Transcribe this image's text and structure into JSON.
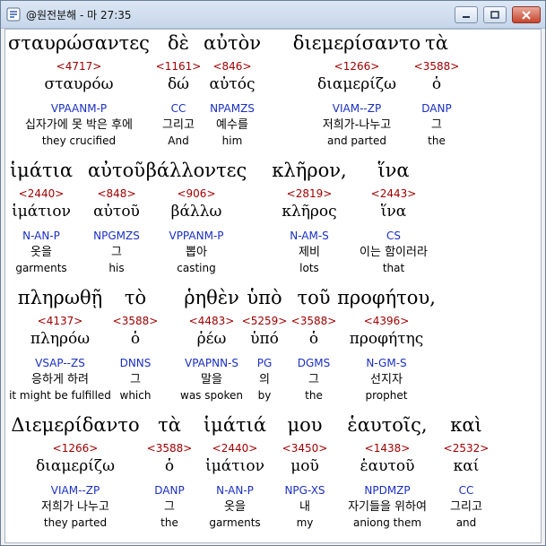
{
  "window": {
    "title": "@원전분해 - 마 27:35",
    "buttons": {
      "minimize": "minimize",
      "maximize": "maximize",
      "close": "close"
    }
  },
  "rows": [
    {
      "words": [
        {
          "greek": "σταυρώσαντες",
          "strong": "<4717>",
          "lexeme": "σταυρόω",
          "parse": "VPAANM-P",
          "korean": "십자가에 못 박은 후에",
          "english": "they crucified",
          "highlighted": true
        },
        {
          "greek": "δὲ",
          "strong": "<1161>",
          "lexeme": "δώ",
          "parse": "CC",
          "korean": "그리고",
          "english": "And"
        },
        {
          "greek": "αὐτὸν",
          "strong": "<846>",
          "lexeme": "αὐτός",
          "parse": "NPAMZS",
          "korean": "예수를",
          "english": "him"
        },
        {
          "greek": "διεμερίσαντο",
          "strong": "<1266>",
          "lexeme": "διαμερίζω",
          "parse": "VIAM--ZP",
          "korean": "저희가-나누고",
          "english": "and parted"
        },
        {
          "greek": "τὰ",
          "strong": "<3588>",
          "lexeme": "ὁ",
          "parse": "DANP",
          "korean": "그",
          "english": "the"
        }
      ]
    },
    {
      "words": [
        {
          "greek": "ἱμάτια",
          "strong": "<2440>",
          "lexeme": "ἱμάτιον",
          "parse": "N-AN-P",
          "korean": "옷을",
          "english": "garments"
        },
        {
          "greek": "αὐτοῦ",
          "strong": "<848>",
          "lexeme": "αὐτοῦ",
          "parse": "NPGMZS",
          "korean": "그",
          "english": "his"
        },
        {
          "greek": "βάλλοντες",
          "strong": "<906>",
          "lexeme": "βάλλω",
          "parse": "VPPANM-P",
          "korean": "뽑아",
          "english": "casting"
        },
        {
          "greek": "κλῆρον,",
          "strong": "<2819>",
          "lexeme": "κλῆρος",
          "parse": "N-AM-S",
          "korean": "제비",
          "english": "lots"
        },
        {
          "greek": "ἵνα",
          "strong": "<2443>",
          "lexeme": "ἵνα",
          "parse": "CS",
          "korean": "이는 함이러라",
          "english": "that"
        }
      ]
    },
    {
      "words": [
        {
          "greek": "πληρωθῇ",
          "strong": "<4137>",
          "lexeme": "πληρόω",
          "parse": "VSAP--ZS",
          "korean": "응하게 하려",
          "english": "it might be fulfilled"
        },
        {
          "greek": "τὸ",
          "strong": "<3588>",
          "lexeme": "ὁ",
          "parse": "DNNS",
          "korean": "그",
          "english": "which"
        },
        {
          "greek": "ῥηθὲν",
          "strong": "<4483>",
          "lexeme": "ῥέω",
          "parse": "VPAPNN-S",
          "korean": "말을",
          "english": "was spoken"
        },
        {
          "greek": "ὑπὸ",
          "strong": "<5259>",
          "lexeme": "ὑπό",
          "parse": "PG",
          "korean": "의",
          "english": "by"
        },
        {
          "greek": "τοῦ",
          "strong": "<3588>",
          "lexeme": "ὁ",
          "parse": "DGMS",
          "korean": "그",
          "english": "the"
        },
        {
          "greek": "προφήτου,",
          "strong": "<4396>",
          "lexeme": "προφήτης",
          "parse": "N-GM-S",
          "korean": "선지자",
          "english": "prophet"
        }
      ]
    },
    {
      "words": [
        {
          "greek": "Διεμερίδαντο",
          "strong": "<1266>",
          "lexeme": "διαμερίζω",
          "parse": "VIAM--ZP",
          "korean": "저희가 나누고",
          "english": "they parted"
        },
        {
          "greek": "τὰ",
          "strong": "<3588>",
          "lexeme": "ὁ",
          "parse": "DANP",
          "korean": "그",
          "english": "the"
        },
        {
          "greek": "ἱμάτιά",
          "strong": "<2440>",
          "lexeme": "ἱμάτιον",
          "parse": "N-AN-P",
          "korean": "옷을",
          "english": "garments"
        },
        {
          "greek": "μου",
          "strong": "<3450>",
          "lexeme": "μοῦ",
          "parse": "NPG-XS",
          "korean": "내",
          "english": "my"
        },
        {
          "greek": "ἑαυτοῖς,",
          "strong": "<1438>",
          "lexeme": "ἑαυτοῦ",
          "parse": "NPDMZP",
          "korean": "자기들을 위하여",
          "english": "aniong them"
        },
        {
          "greek": "καὶ",
          "strong": "<2532>",
          "lexeme": "καί",
          "parse": "CC",
          "korean": "그리고",
          "english": "and"
        }
      ]
    }
  ]
}
